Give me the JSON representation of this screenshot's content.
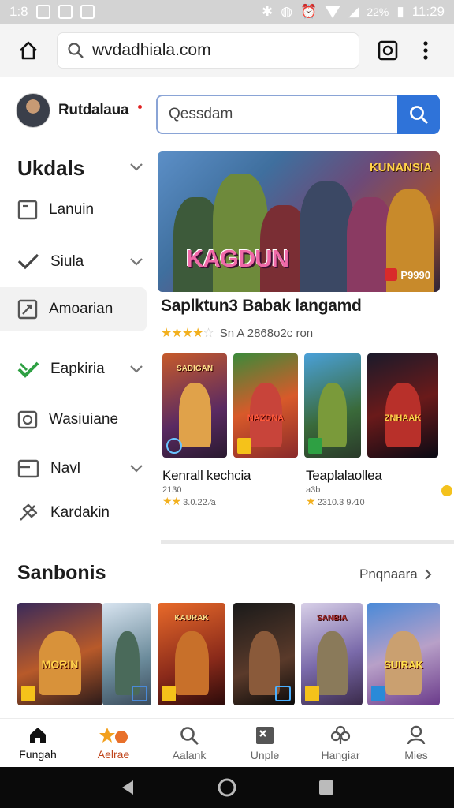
{
  "status_bar": {
    "time_left": "1:8",
    "time_right": "11:29",
    "signal_text": "22%"
  },
  "browser": {
    "url": "wvdadhiala.com"
  },
  "profile": {
    "name": "Rutdalaua"
  },
  "sidebar": {
    "heading": "Ukdals",
    "items": [
      {
        "label": "Lanuin",
        "icon": "square-icon",
        "has_chevron": false
      },
      {
        "label": "Siula",
        "icon": "check-icon",
        "has_chevron": true
      },
      {
        "label": "Amoarian",
        "icon": "chart-icon",
        "has_chevron": false,
        "active": true
      },
      {
        "label": "Eapkiria",
        "icon": "green-check-icon",
        "has_chevron": true
      },
      {
        "label": "Wasiuiane",
        "icon": "camera-icon",
        "has_chevron": false
      },
      {
        "label": "Navl",
        "icon": "card-icon",
        "has_chevron": true
      },
      {
        "label": "Kardakin",
        "icon": "tag-icon",
        "has_chevron": false
      }
    ]
  },
  "search": {
    "placeholder": "Qessdam"
  },
  "featured": {
    "banner_title": "KAGDUN",
    "banner_corner": "KUNANSIA",
    "banner_badge": "P9990",
    "title": "Saplktun3 Babak langamd",
    "rating": 4,
    "meta": "Sn A 2868o2c ron"
  },
  "grid_cards": [
    {
      "caption": "SADIGAN"
    },
    {
      "caption": "NAZDNA"
    },
    {
      "caption": ""
    },
    {
      "caption": "ZNHAAK"
    }
  ],
  "grid_games": [
    {
      "title": "Kenrall kechcia",
      "sub": "2130",
      "rating": "3.0.22 ⁄a",
      "stars": 2
    },
    {
      "title": "Teaplalaollea",
      "sub": "a3b",
      "rating": "2310.3 9 ⁄10",
      "stars": 1
    }
  ],
  "section2": {
    "title": "Sanbonis",
    "see_more": "Pnqnaara",
    "cards": [
      {
        "caption": "MORIN"
      },
      {
        "caption": "KAURAK"
      },
      {
        "caption": ""
      },
      {
        "caption": "SANBIA"
      },
      {
        "caption": "SUIRAK"
      }
    ]
  },
  "bottom_nav": [
    {
      "label": "Fungah",
      "icon": "home-icon",
      "active": true
    },
    {
      "label": "Aelrae",
      "icon": "star-badge-icon",
      "active": false
    },
    {
      "label": "Aalank",
      "icon": "search-icon",
      "active": false
    },
    {
      "label": "Unple",
      "icon": "x-box-icon",
      "active": false
    },
    {
      "label": "Hangiar",
      "icon": "clover-icon",
      "active": false
    },
    {
      "label": "Mies",
      "icon": "person-icon",
      "active": false
    }
  ],
  "colors": {
    "accent": "#2f73d9",
    "star": "#f2b01e",
    "status_bar": "#d3d3d3"
  }
}
